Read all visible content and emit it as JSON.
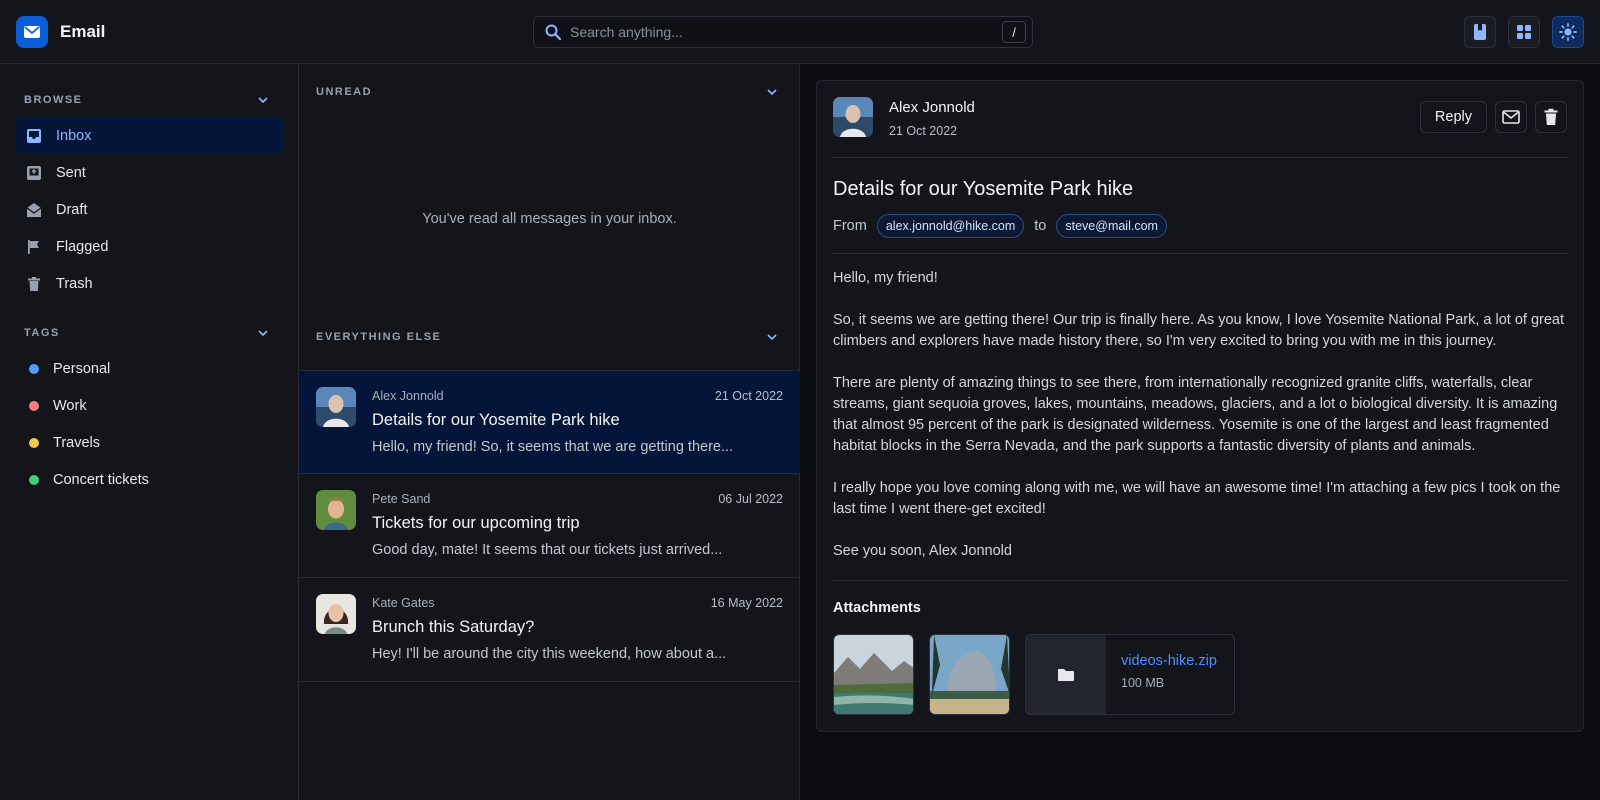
{
  "app": {
    "title": "Email"
  },
  "search": {
    "placeholder": "Search anything...",
    "shortcut": "/"
  },
  "top_actions": [
    "bookmark-icon",
    "grid-icon",
    "sun-icon"
  ],
  "sidebar": {
    "browse_label": "BROWSE",
    "items": [
      {
        "label": "Inbox",
        "icon": "inbox-icon",
        "active": true
      },
      {
        "label": "Sent",
        "icon": "sent-icon"
      },
      {
        "label": "Draft",
        "icon": "draft-icon"
      },
      {
        "label": "Flagged",
        "icon": "flag-icon"
      },
      {
        "label": "Trash",
        "icon": "trash-icon"
      }
    ],
    "tags_label": "TAGS",
    "tags": [
      {
        "label": "Personal",
        "color": "#4f9dff"
      },
      {
        "label": "Work",
        "color": "#ff7b7b"
      },
      {
        "label": "Travels",
        "color": "#f2c94c"
      },
      {
        "label": "Concert tickets",
        "color": "#3fcf7f"
      }
    ]
  },
  "list": {
    "unread_label": "UNREAD",
    "empty_message": "You've read all messages in your inbox.",
    "else_label": "EVERYTHING ELSE",
    "messages": [
      {
        "sender": "Alex Jonnold",
        "date": "21 Oct 2022",
        "subject": "Details for our Yosemite Park hike",
        "preview": "Hello, my friend! So, it seems that we are getting there...",
        "active": true
      },
      {
        "sender": "Pete Sand",
        "date": "06 Jul 2022",
        "subject": "Tickets for our upcoming trip",
        "preview": "Good day, mate! It seems that our tickets just arrived..."
      },
      {
        "sender": "Kate Gates",
        "date": "16 May 2022",
        "subject": "Brunch this Saturday?",
        "preview": "Hey! I'll be around the city this weekend, how about a..."
      }
    ]
  },
  "reader": {
    "sender": "Alex Jonnold",
    "date": "21 Oct 2022",
    "reply_label": "Reply",
    "subject": "Details for our Yosemite Park hike",
    "from_word": "From",
    "from_email": "alex.jonnold@hike.com",
    "to_word": "to",
    "to_email": "steve@mail.com",
    "body": [
      "Hello, my friend!",
      "So, it seems we are getting there! Our trip is finally here. As you know, I love Yosemite National Park, a lot of great climbers and explorers have made history there, so I'm very excited to bring you with me in this journey.",
      "There are plenty of amazing things to see there, from internationally recognized granite cliffs, waterfalls, clear streams, giant sequoia groves, lakes, mountains, meadows, glaciers, and a lot o biological diversity. It is amazing that almost 95 percent of the park is designated wilderness. Yosemite is one of the largest and least fragmented habitat blocks in the Serra Nevada, and the park supports a fantastic diversity of plants and animals.",
      "I really hope you love coming along with me, we will have an awesome time! I'm attaching a few pics I took on the last time I went there-get excited!",
      "See you soon, Alex Jonnold"
    ],
    "attachments_title": "Attachments",
    "file": {
      "name": "videos-hike.zip",
      "size": "100 MB"
    }
  }
}
